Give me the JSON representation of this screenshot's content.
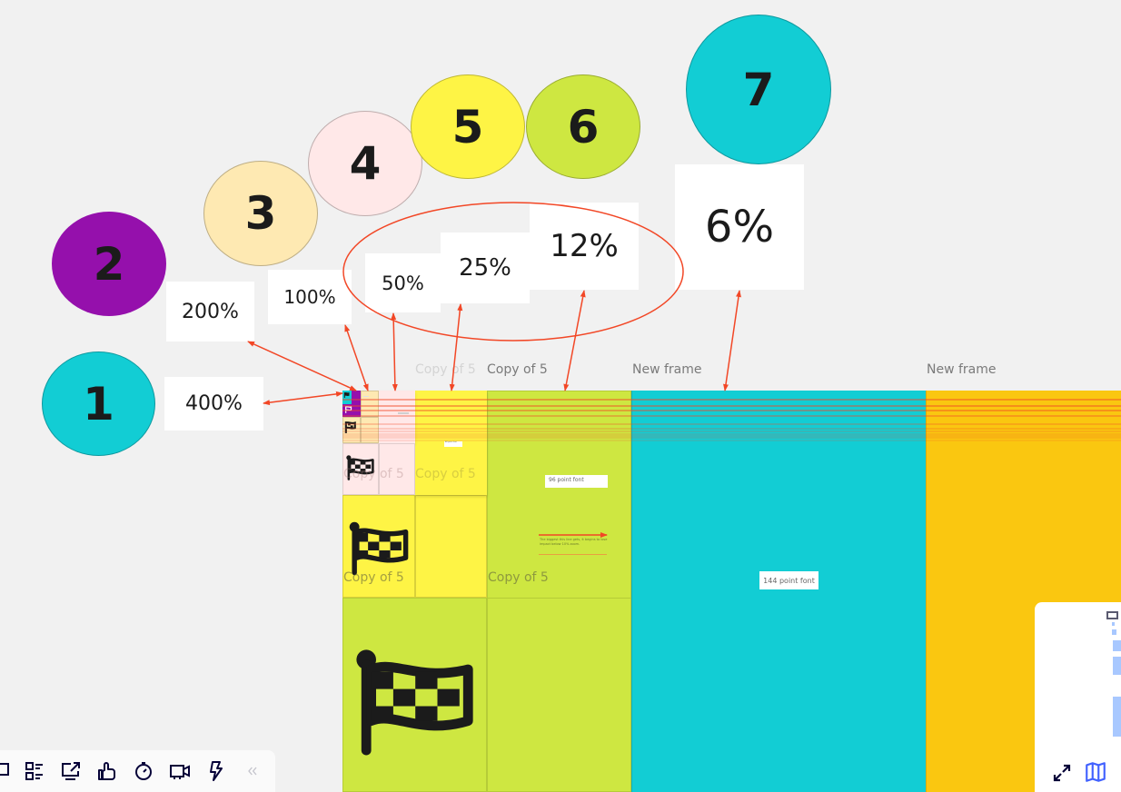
{
  "circles": [
    {
      "label": "1",
      "color": "#12cdd4"
    },
    {
      "label": "2",
      "color": "#9510ac"
    },
    {
      "label": "3",
      "color": "#fee9b2"
    },
    {
      "label": "4",
      "color": "#ffe8e8"
    },
    {
      "label": "5",
      "color": "#fef445"
    },
    {
      "label": "6",
      "color": "#cee741"
    },
    {
      "label": "7",
      "color": "#12cdd4"
    }
  ],
  "zoom_cards": [
    {
      "label": "400%"
    },
    {
      "label": "200%"
    },
    {
      "label": "100%"
    },
    {
      "label": "50%"
    },
    {
      "label": "25%"
    },
    {
      "label": "12%"
    },
    {
      "label": "6%"
    }
  ],
  "frames": {
    "titles": [
      "Copy of 5",
      "Copy of 5",
      "New frame",
      "New frame"
    ],
    "inner_labels": [
      "Copy of 5",
      "Copy of 5",
      "Copy of 5",
      "Copy of 5"
    ]
  },
  "stickies": {
    "font96": "96 point font",
    "font144": "144 point font",
    "font_small": "48 point font",
    "note": "The biggest this line gets, it begins to lose impact below 10% zoom."
  },
  "toolbar": {
    "items": [
      {
        "icon": "comment-icon",
        "label": "Comment"
      },
      {
        "icon": "cards-icon",
        "label": "Cards"
      },
      {
        "icon": "share-screen-icon",
        "label": "Share screen"
      },
      {
        "icon": "thumbs-up-icon",
        "label": "Voting"
      },
      {
        "icon": "timer-icon",
        "label": "Timer"
      },
      {
        "icon": "video-icon",
        "label": "Video chat"
      },
      {
        "icon": "lightning-icon",
        "label": "Integrations"
      },
      {
        "icon": "collapse-icon",
        "label": "Collapse"
      }
    ]
  },
  "colors": {
    "accent_red": "#f24726",
    "canvas": "#f1f1f1",
    "cyan": "#12cdd4",
    "purple": "#9510ac",
    "peach": "#fee9b2",
    "pink": "#ffe8e8",
    "yellow": "#fef445",
    "lime": "#cee741",
    "orange": "#fac710"
  }
}
